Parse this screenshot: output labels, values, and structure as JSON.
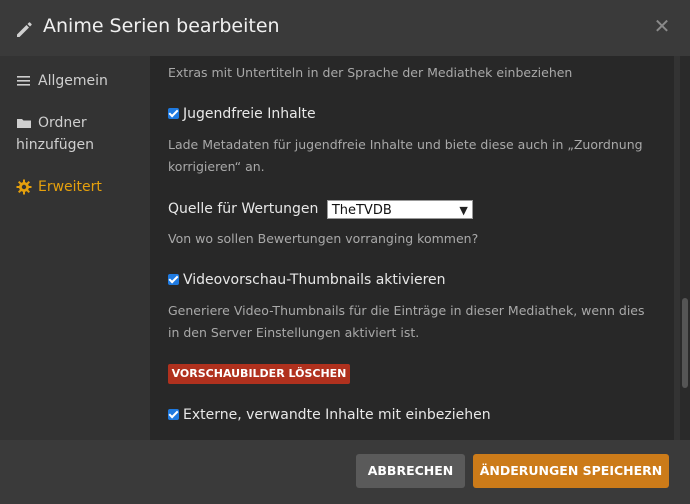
{
  "header": {
    "title": "Anime Serien bearbeiten"
  },
  "sidebar": {
    "items": [
      {
        "label": "Allgemein",
        "icon": "list-icon"
      },
      {
        "label": "Ordner hinzufügen",
        "icon": "folder-icon"
      },
      {
        "label": "Erweitert",
        "icon": "gear-icon",
        "active": true
      }
    ]
  },
  "content": {
    "extras_desc": "Extras mit Untertiteln in der Sprache der Mediathek einbeziehen",
    "family_label": "Jugendfreie Inhalte",
    "family_desc": "Lade Metadaten für jugendfreie Inhalte und biete diese auch in „Zuordnung korrigieren“ an.",
    "rating_label": "Quelle für Wertungen",
    "rating_value": "TheTVDB",
    "rating_desc": "Von wo sollen Bewertungen vorranging kommen?",
    "thumb_label": "Videovorschau-Thumbnails aktivieren",
    "thumb_desc": "Generiere Video-Thumbnails für die Einträge in dieser Mediathek, wenn dies in den Server Einstellungen aktiviert ist.",
    "delete_button": "VORSCHAUBILDER LÖSCHEN",
    "external_label": "Externe, verwandte Inhalte mit einbeziehen"
  },
  "footer": {
    "cancel": "ABBRECHEN",
    "save": "ÄNDERUNGEN SPEICHERN"
  },
  "colors": {
    "accent": "#e5a00d",
    "save": "#cc7b19",
    "danger": "#b0311e",
    "checkbox": "#1f7ae0"
  }
}
